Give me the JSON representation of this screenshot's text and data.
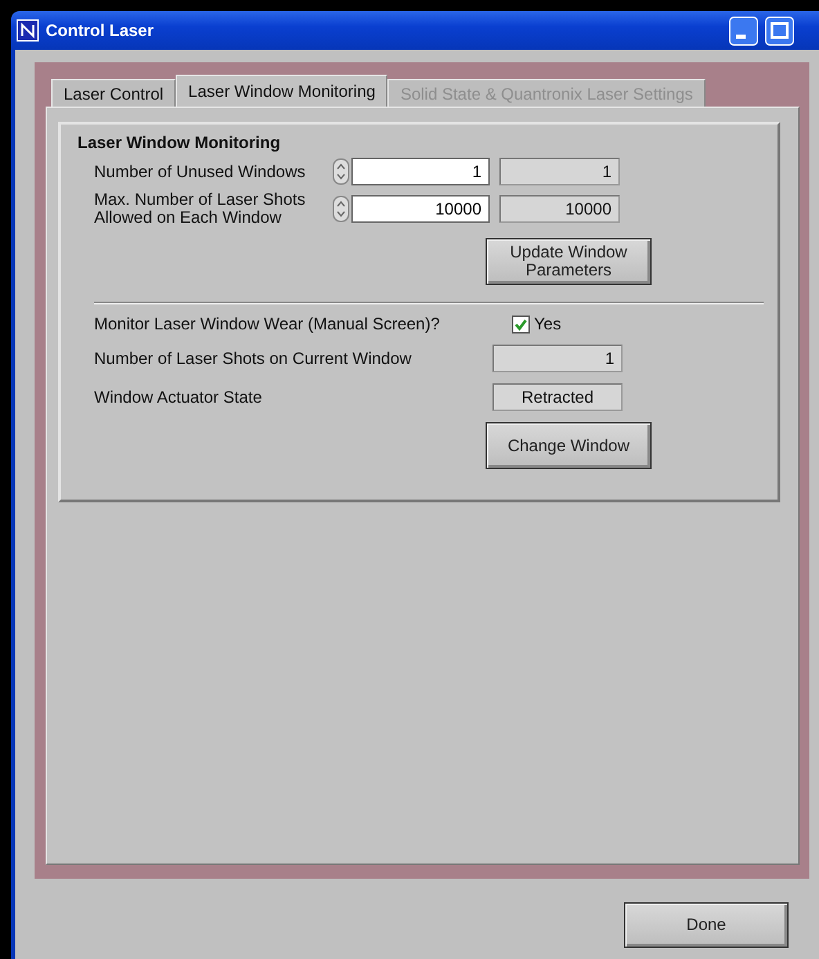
{
  "window": {
    "title": "Control Laser"
  },
  "tabs": [
    {
      "label": "Laser Control",
      "selected": false,
      "disabled": false
    },
    {
      "label": "Laser Window Monitoring",
      "selected": true,
      "disabled": false
    },
    {
      "label": "Solid State & Quantronix Laser Settings",
      "selected": false,
      "disabled": true
    }
  ],
  "group": {
    "heading": "Laser Window Monitoring",
    "parameters": [
      {
        "label": "Number of Unused Windows",
        "value": "1",
        "readback": "1"
      },
      {
        "label": "Max. Number of Laser Shots Allowed on Each Window",
        "value": "10000",
        "readback": "10000"
      }
    ],
    "update_button": "Update Window Parameters",
    "monitor": {
      "label": "Monitor Laser Window Wear (Manual Screen)?",
      "option": "Yes",
      "checked": true
    },
    "indicators": [
      {
        "label": "Number of Laser Shots on Current Window",
        "value": "1",
        "kind": "count"
      },
      {
        "label": "Window Actuator State",
        "value": "Retracted",
        "kind": "state"
      }
    ],
    "change_button": "Change Window"
  },
  "done_button": "Done"
}
